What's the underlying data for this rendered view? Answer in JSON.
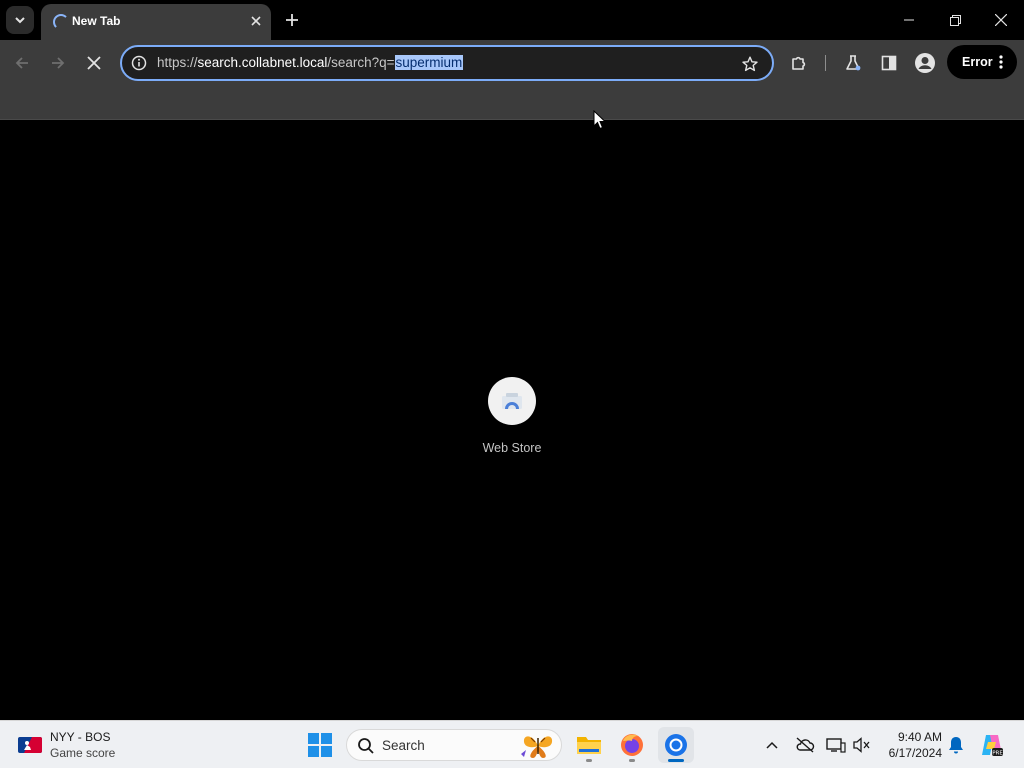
{
  "tab": {
    "title": "New Tab"
  },
  "omnibox": {
    "scheme": "https://",
    "host": "search.collabnet.local",
    "path": "/search?q=",
    "selected": "supermium"
  },
  "profile": {
    "error_label": "Error"
  },
  "shortcut": {
    "label": "Web Store"
  },
  "taskbar": {
    "widget_title": "NYY - BOS",
    "widget_subtitle": "Game score",
    "search_placeholder": "Search",
    "time": "9:40 AM",
    "date": "6/17/2024"
  },
  "icons": {
    "tab_search": "chevron-down-icon",
    "loading": "spinner-icon",
    "tab_close": "close-icon",
    "new_tab": "plus-icon",
    "back": "arrow-left-icon",
    "forward": "arrow-right-icon",
    "stop": "close-icon",
    "site_info": "info-icon",
    "bookmark": "star-icon",
    "extensions": "puzzle-icon",
    "labs": "flask-icon",
    "side_panel": "side-panel-icon",
    "profile": "person-icon",
    "menu": "more-vert-icon"
  },
  "colors": {
    "accent": "#7cacf8",
    "selection": "#a8c7fa",
    "toolbar": "#3c3c3c",
    "taskbar": "#eef0f3",
    "windows_blue": "#0067c0"
  }
}
